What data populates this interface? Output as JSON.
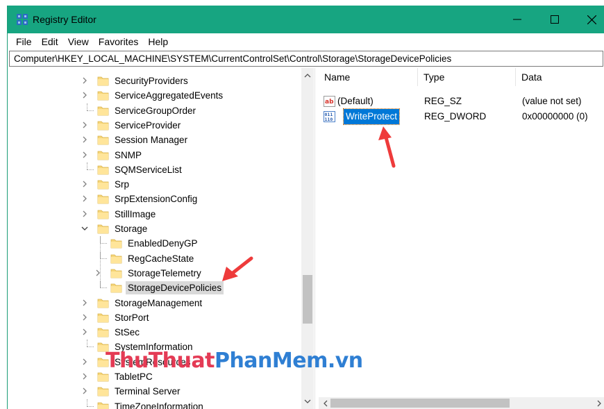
{
  "window": {
    "title": "Registry Editor",
    "accent_color": "#17a581",
    "controls": [
      "minimize-icon",
      "maximize-icon",
      "close-icon"
    ]
  },
  "menu": [
    "File",
    "Edit",
    "View",
    "Favorites",
    "Help"
  ],
  "address": "Computer\\HKEY_LOCAL_MACHINE\\SYSTEM\\CurrentControlSet\\Control\\Storage\\StorageDevicePolicies",
  "tree": [
    {
      "label": "SecurityProviders",
      "expandable": true
    },
    {
      "label": "ServiceAggregatedEvents",
      "expandable": true
    },
    {
      "label": "ServiceGroupOrder",
      "expandable": false
    },
    {
      "label": "ServiceProvider",
      "expandable": true
    },
    {
      "label": "Session Manager",
      "expandable": true
    },
    {
      "label": "SNMP",
      "expandable": true
    },
    {
      "label": "SQMServiceList",
      "expandable": false
    },
    {
      "label": "Srp",
      "expandable": true
    },
    {
      "label": "SrpExtensionConfig",
      "expandable": true
    },
    {
      "label": "StillImage",
      "expandable": true
    },
    {
      "label": "Storage",
      "expandable": true,
      "expanded": true
    },
    {
      "label": "EnabledDenyGP",
      "expandable": false,
      "child": true
    },
    {
      "label": "RegCacheState",
      "expandable": false,
      "child": true
    },
    {
      "label": "StorageTelemetry",
      "expandable": true,
      "child": true
    },
    {
      "label": "StorageDevicePolicies",
      "expandable": false,
      "child": true,
      "selected": true
    },
    {
      "label": "StorageManagement",
      "expandable": true
    },
    {
      "label": "StorPort",
      "expandable": true
    },
    {
      "label": "StSec",
      "expandable": true
    },
    {
      "label": "SystemInformation",
      "expandable": false
    },
    {
      "label": "SystemResources",
      "expandable": true
    },
    {
      "label": "TabletPC",
      "expandable": true
    },
    {
      "label": "Terminal Server",
      "expandable": true
    },
    {
      "label": "TimeZoneInformation",
      "expandable": false
    }
  ],
  "columns": [
    "Name",
    "Type",
    "Data"
  ],
  "values": [
    {
      "name": "(Default)",
      "type": "REG_SZ",
      "data": "(value not set)",
      "icon": "string-value-icon",
      "selected": false
    },
    {
      "name": "WriteProtect",
      "type": "REG_DWORD",
      "data": "0x00000000 (0)",
      "icon": "dword-value-icon",
      "selected": true
    }
  ],
  "watermark": {
    "part1": "Thu",
    "part2": "Thuat",
    "part3": "PhanMem",
    "part4": ".vn"
  },
  "annotation_color": "#ee3b3b"
}
